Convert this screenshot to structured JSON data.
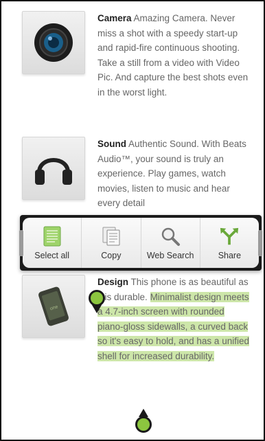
{
  "features": [
    {
      "title": "Camera",
      "body": "Amazing Camera. Never miss a shot with a speedy start-up and rapid-fire continuous shooting. Take a still from a video with Video Pic. And capture the best shots even in the worst light.",
      "icon": "camera-lens-icon"
    },
    {
      "title": "Sound",
      "body": "Authentic Sound. With Beats Audio™, your sound is truly an experience. Play games, watch movies, listen to music and hear every detail",
      "icon": "headphones-icon"
    },
    {
      "title": "Design",
      "body_plain": "This phone is as beautiful as it is durable.",
      "body_selected": "Minimalist design meets a 4.7-inch screen with rounded piano-gloss sidewalls, a curved back so it's easy to hold, and has a unified shell for increased durability.",
      "icon": "phone-icon"
    }
  ],
  "toolbar": {
    "select_all": "Select all",
    "copy": "Copy",
    "web_search": "Web Search",
    "share": "Share"
  },
  "colors": {
    "selection": "#cde6a9",
    "handle": "#8cc63f",
    "toolbar_frame": "#1b1b1b"
  }
}
